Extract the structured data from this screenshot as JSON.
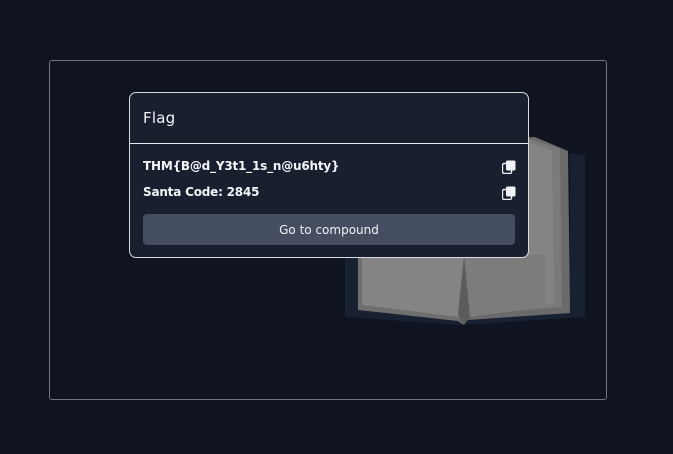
{
  "modal": {
    "title": "Flag",
    "flag_text": "THM{B@d_Y3t1_1s_n@u6hty}",
    "santa_code_text": "Santa Code: 2845",
    "go_button_label": "Go to compound"
  },
  "icons": {
    "copy": "copy-icon",
    "book": "open-book-illustration"
  },
  "colors": {
    "background": "#0f1420",
    "modal_bg": "#182030",
    "button_bg": "#454e60",
    "text": "#f4f5f7"
  }
}
